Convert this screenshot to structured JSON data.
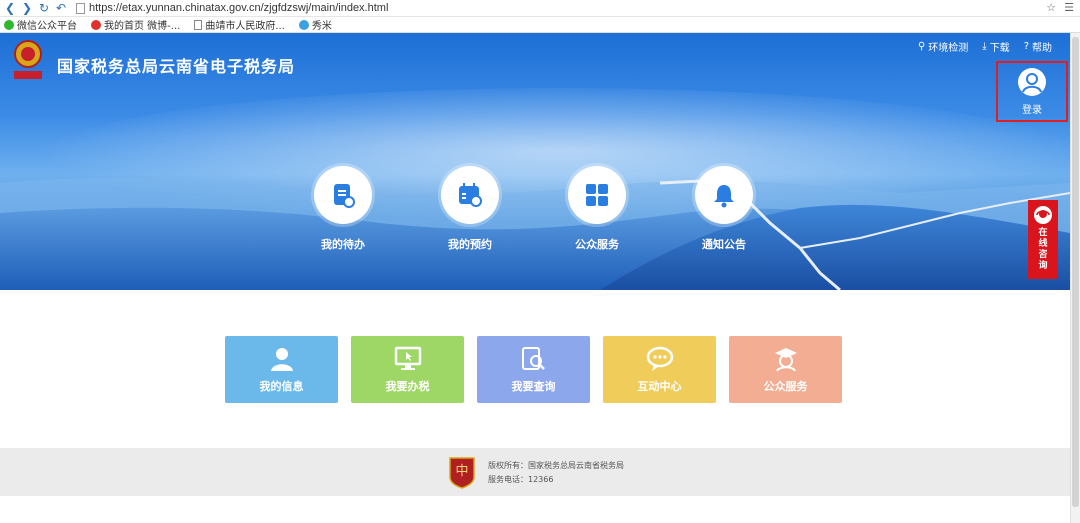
{
  "browser": {
    "url": "https://etax.yunnan.chinatax.gov.cn/zjgfdzswj/main/index.html",
    "bookmarks": [
      {
        "label": "微信公众平台",
        "color": "#2db82d"
      },
      {
        "label": "我的首页 微博-...",
        "color": "#e0322c"
      },
      {
        "label": "曲靖市人民政府...",
        "color": "doc"
      },
      {
        "label": "秀米",
        "color": "#3aa0e0"
      }
    ]
  },
  "header": {
    "title": "国家税务总局云南省电子税务局",
    "links": [
      {
        "icon": "wrench-icon",
        "glyph": "⚲",
        "label": "环境检测"
      },
      {
        "icon": "download-icon",
        "glyph": "⤓",
        "label": "下载"
      },
      {
        "icon": "help-icon",
        "glyph": "?",
        "label": "帮助"
      }
    ],
    "login_label": "登录"
  },
  "features": [
    {
      "name": "todo",
      "icon": "task-list-icon",
      "label": "我的待办"
    },
    {
      "name": "appointment",
      "icon": "calendar-icon",
      "label": "我的预约"
    },
    {
      "name": "public-service",
      "icon": "grid-icon",
      "label": "公众服务"
    },
    {
      "name": "notice",
      "icon": "bell-icon",
      "label": "通知公告"
    }
  ],
  "online_consult": {
    "label": "在线咨询",
    "chars": [
      "在",
      "线",
      "咨",
      "询"
    ]
  },
  "tiles": [
    {
      "name": "my-info",
      "icon": "user-icon",
      "label": "我的信息",
      "color": "#6bb8ea"
    },
    {
      "name": "tax-filing",
      "icon": "monitor-icon",
      "label": "我要办税",
      "color": "#9ed766"
    },
    {
      "name": "query",
      "icon": "document-search-icon",
      "label": "我要查询",
      "color": "#8da7ec"
    },
    {
      "name": "interaction",
      "icon": "chat-bubble-icon",
      "label": "互动中心",
      "color": "#f0cd5b"
    },
    {
      "name": "public-service",
      "icon": "graduate-icon",
      "label": "公众服务",
      "color": "#f3ad93"
    }
  ],
  "footer": {
    "copyright": "版权所有：国家税务总局云南省税务局",
    "phone": "服务电话：12366"
  }
}
